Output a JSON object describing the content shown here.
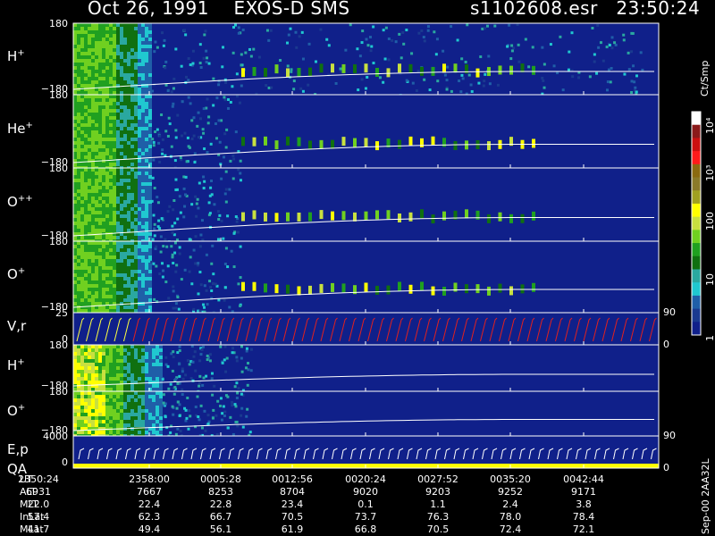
{
  "header": {
    "date": "Oct 26, 1991",
    "instrument": "EXOS-D SMS",
    "file_id": "s1102608.esr",
    "time": "23:50:24"
  },
  "panels": [
    {
      "label": "H",
      "sup": "+",
      "ytop": "180",
      "ybot": "−180"
    },
    {
      "label": "He",
      "sup": "+",
      "ytop": "180",
      "ybot": "−180"
    },
    {
      "label": "O",
      "sup": "++",
      "ytop": "180",
      "ybot": "−180"
    },
    {
      "label": "O",
      "sup": "+",
      "ytop": "180",
      "ybot": "−180",
      "rtick": "90"
    },
    {
      "label": "V,r",
      "sup": "",
      "ytop": "25",
      "ybot": "0",
      "rtick": "0"
    },
    {
      "label": "H",
      "sup": "+",
      "ytop": "180",
      "ybot": "−180"
    },
    {
      "label": "O",
      "sup": "+",
      "ytop": "180",
      "ybot": "−180",
      "rtick": "90"
    },
    {
      "label": "E,p",
      "sup": "",
      "ytop": "4000",
      "ybot": "0",
      "rtick": "0",
      "label2": "QA"
    }
  ],
  "colorbar": {
    "unit_label": "Ct/Smp",
    "ticks": [
      "10⁴",
      "10³",
      "100",
      "10",
      "1"
    ],
    "colors": [
      "#ffffff",
      "#8b1a1a",
      "#cc1010",
      "#ff1a1a",
      "#8b6a10",
      "#8b7a2a",
      "#a0a020",
      "#ffff00",
      "#c8e040",
      "#70d020",
      "#20a020",
      "#107010",
      "#2aa8a0",
      "#20c8d0",
      "#1f5fa8",
      "#1a3a90",
      "#10208a"
    ]
  },
  "footer": {
    "rows": [
      {
        "label": "UT",
        "values": [
          "2350:24",
          "2358:00",
          "0005:28",
          "0012:56",
          "0020:24",
          "0027:52",
          "0035:20",
          "0042:44"
        ]
      },
      {
        "label": "ALT",
        "values": [
          "6931",
          "7667",
          "8253",
          "8704",
          "9020",
          "9203",
          "9252",
          "9171"
        ]
      },
      {
        "label": "MLT",
        "values": [
          "22.0",
          "22.4",
          "22.8",
          "23.4",
          "0.1",
          "1.1",
          "2.4",
          "3.8"
        ]
      },
      {
        "label": "InLat",
        "values": [
          "57.4",
          "62.3",
          "66.7",
          "70.5",
          "73.7",
          "76.3",
          "78.0",
          "78.4"
        ]
      },
      {
        "label": "MLat",
        "values": [
          "41.7",
          "49.4",
          "56.1",
          "61.9",
          "66.8",
          "70.5",
          "72.4",
          "72.1"
        ]
      }
    ],
    "footnote": "Sep-00  2AA32L"
  }
}
